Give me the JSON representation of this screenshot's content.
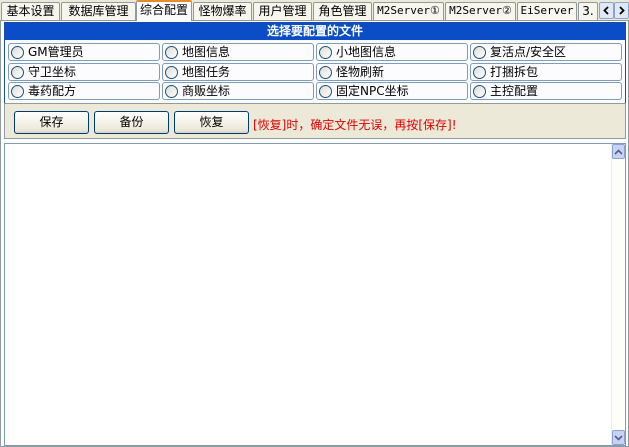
{
  "tabs": [
    {
      "label": "基本设置"
    },
    {
      "label": "数据库管理"
    },
    {
      "label": "综合配置",
      "active": true
    },
    {
      "label": "怪物爆率"
    },
    {
      "label": "用户管理"
    },
    {
      "label": "角色管理"
    },
    {
      "label": "M2Server①"
    },
    {
      "label": "M2Server②"
    },
    {
      "label": "EiServer"
    },
    {
      "label": "3."
    }
  ],
  "file_group": {
    "title": "选择要配置的文件",
    "options": [
      "GM管理员",
      "地图信息",
      "小地图信息",
      "复活点/安全区",
      "守卫坐标",
      "地图任务",
      "怪物刷新",
      "打捆拆包",
      "毒药配方",
      "商贩坐标",
      "固定NPC坐标",
      "主控配置"
    ]
  },
  "actions": {
    "save": "保存",
    "backup": "备份",
    "restore": "恢复",
    "hint": "[恢复]时，确定文件无误，再按[保存]!"
  },
  "colors": {
    "title_bar": "#0b4dc7",
    "hint_text": "#e00000",
    "active_tab_accent": "#e68b2c"
  },
  "icons": {
    "tab_scroll_left": "chevron-left-icon",
    "tab_scroll_right": "chevron-right-icon",
    "editor_scroll_up": "chevron-up-icon",
    "editor_scroll_down": "chevron-down-icon"
  }
}
